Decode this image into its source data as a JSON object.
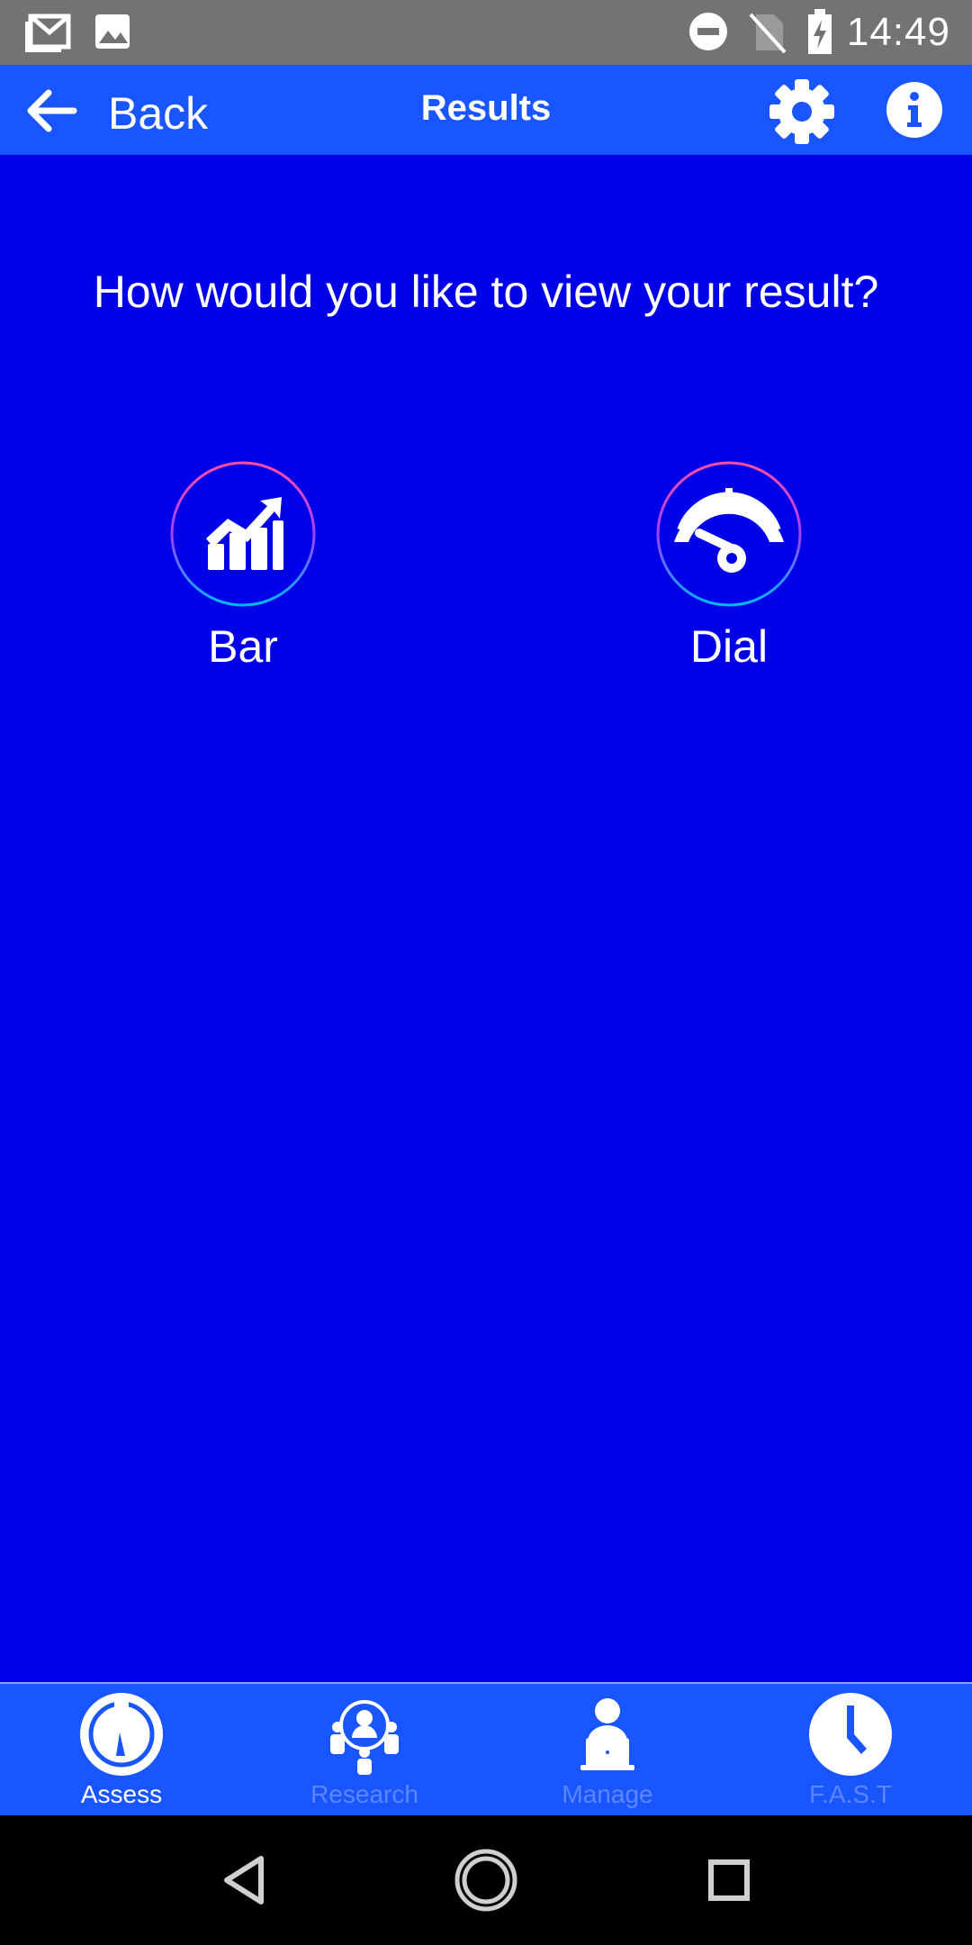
{
  "status_bar": {
    "time": "14:49",
    "icons": [
      "gmail-icon",
      "image-icon",
      "do-not-disturb-icon",
      "no-sim-icon",
      "battery-charging-icon"
    ]
  },
  "app_bar": {
    "back_label": "Back",
    "title": "Results",
    "icons": [
      "back-arrow-icon",
      "gear-icon",
      "info-icon"
    ]
  },
  "main": {
    "question": "How would you like to view your result?",
    "options": [
      {
        "label": "Bar",
        "icon": "bar-chart-icon"
      },
      {
        "label": "Dial",
        "icon": "dial-gauge-icon"
      }
    ]
  },
  "bottom_nav": {
    "items": [
      {
        "label": "Assess",
        "icon": "gauge-icon",
        "active": true
      },
      {
        "label": "Research",
        "icon": "research-people-icon",
        "active": false
      },
      {
        "label": "Manage",
        "icon": "manager-laptop-icon",
        "active": false
      },
      {
        "label": "F.A.S.T",
        "icon": "clock-icon",
        "active": false
      }
    ]
  },
  "colors": {
    "background": "#0000e6",
    "app_bar": "#1a56ff",
    "status_bar": "#737373",
    "active_label": "#ffffff",
    "inactive_label": "#5b86ff",
    "option_ring_start": "#ff4fa0",
    "option_ring_end": "#00b7ff"
  }
}
